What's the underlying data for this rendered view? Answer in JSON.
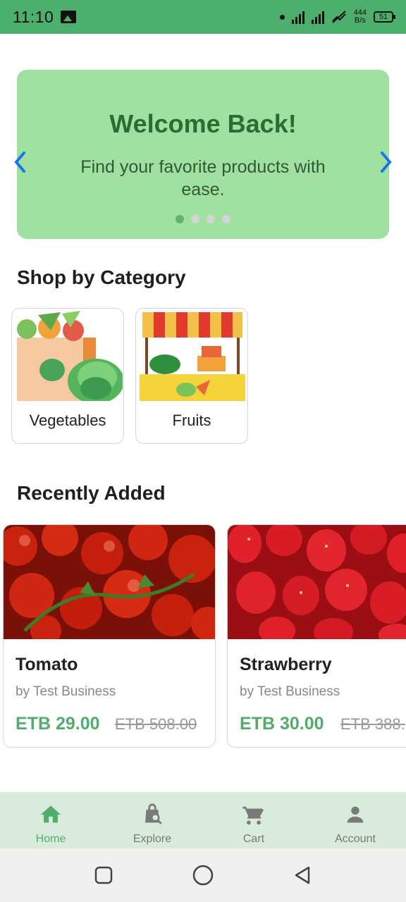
{
  "status_bar": {
    "time": "11:10",
    "net_rate_top": "444",
    "net_rate_bottom": "B/s",
    "battery": "51",
    "icons": [
      "image-icon",
      "dot-icon",
      "signal-icon",
      "wifi-off-icon",
      "battery-icon"
    ]
  },
  "banner": {
    "title": "Welcome Back!",
    "subtitle": "Find your favorite products with ease.",
    "slide_count": 4,
    "active_slide": 1,
    "background": "#a0e1a1",
    "arrow_color": "#1a73e8"
  },
  "categories": {
    "title": "Shop by Category",
    "items": [
      {
        "label": "Vegetables",
        "icon": "grocery-bag-illustration"
      },
      {
        "label": "Fruits",
        "icon": "market-stall-illustration"
      }
    ]
  },
  "recent": {
    "title": "Recently Added",
    "products": [
      {
        "name": "Tomato",
        "seller": "by Test Business",
        "price": "ETB 29.00",
        "old_price": "ETB 508.00"
      },
      {
        "name": "Strawberry",
        "seller": "by Test Business",
        "price": "ETB 30.00",
        "old_price": "ETB 388."
      }
    ]
  },
  "bottom_nav": {
    "items": [
      {
        "label": "Home",
        "icon": "home-icon",
        "active": true
      },
      {
        "label": "Explore",
        "icon": "shopping-bag-search-icon",
        "active": false
      },
      {
        "label": "Cart",
        "icon": "cart-icon",
        "active": false
      },
      {
        "label": "Account",
        "icon": "person-icon",
        "active": false
      }
    ],
    "accent": "#4fae6a"
  },
  "system_nav": {
    "icons": [
      "recents-square-icon",
      "home-circle-icon",
      "back-triangle-icon"
    ]
  }
}
